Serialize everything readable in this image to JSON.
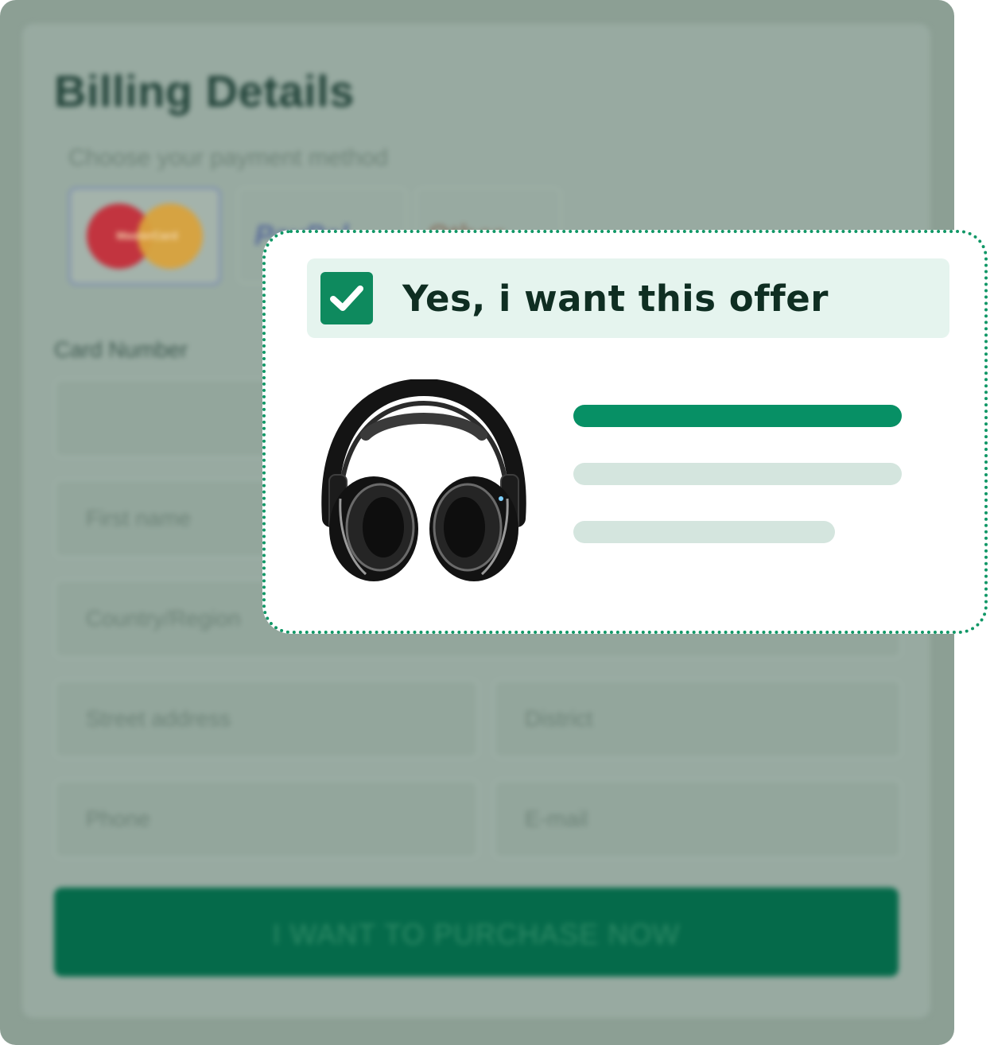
{
  "billing": {
    "title": "Billing Details",
    "subtitle": "Choose your payment method",
    "payment_methods": [
      "MasterCard",
      "PayPal",
      "Other"
    ],
    "card_number_label": "Card Number",
    "placeholders": {
      "first_name": "First name",
      "country": "Country/Region",
      "street": "Street address",
      "district": "District",
      "phone": "Phone",
      "email": "E-mail"
    },
    "purchase_button": "I WANT TO PURCHASE NOW"
  },
  "offer": {
    "checkbox_checked": true,
    "label": "Yes, i want this offer",
    "product_icon": "headphones-image"
  },
  "colors": {
    "accent": "#079065",
    "check_bg": "#0e8a5e",
    "offer_bar_bg": "#e5f4ee",
    "placeholder_line": "#d4e5de",
    "overlay": "#8c9f94"
  }
}
